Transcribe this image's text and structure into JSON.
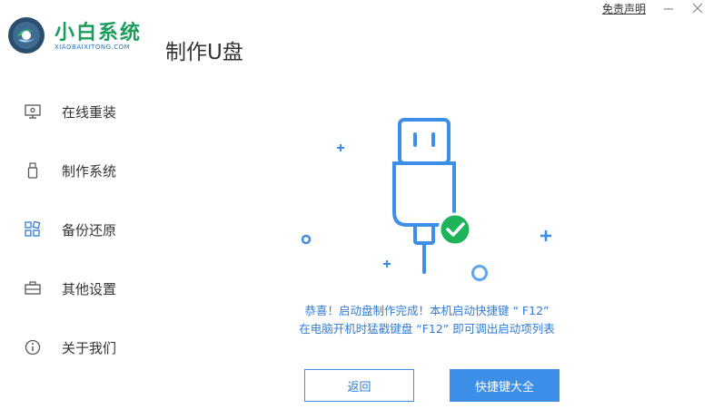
{
  "app": {
    "name_cn": "小白系统",
    "name_en": "XIAOBAIXITONG.COM",
    "page_title": "制作U盘"
  },
  "topbar": {
    "disclaimer": "免责声明",
    "minimize_icon": "minimize-icon",
    "close_icon": "close-icon"
  },
  "sidebar": {
    "items": [
      {
        "label": "在线重装",
        "icon": "monitor-icon"
      },
      {
        "label": "制作系统",
        "icon": "usb-drive-icon"
      },
      {
        "label": "备份还原",
        "icon": "grid-icon",
        "active": true
      },
      {
        "label": "其他设置",
        "icon": "toolbox-icon"
      },
      {
        "label": "关于我们",
        "icon": "info-icon"
      }
    ]
  },
  "main": {
    "message_line1": "恭喜！启动盘制作完成！本机启动快捷键 “ F12”",
    "message_line2": "在电脑开机时猛戳键盘 “F12” 即可调出启动项列表",
    "back_button": "返回",
    "shortcut_button": "快捷键大全"
  },
  "colors": {
    "accent": "#3d8ee6",
    "brand_green": "#1a9c5a",
    "success": "#1fb35c"
  }
}
